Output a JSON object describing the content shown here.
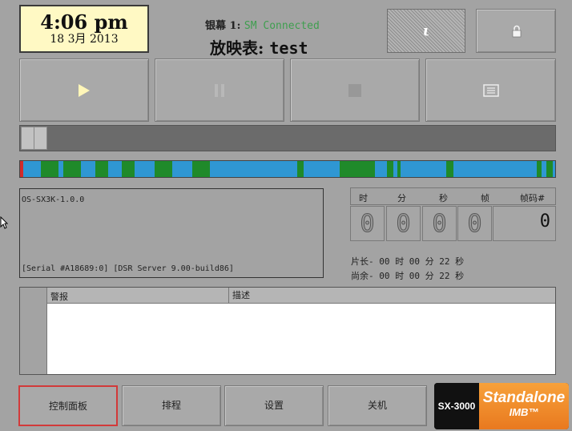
{
  "clock": {
    "time": "4:06 pm",
    "date": "18  3月 2013"
  },
  "header": {
    "screen_label": "银幕 1:",
    "connection_status": "SM Connected",
    "playlist_label": "放映表:",
    "playlist_name": "test",
    "status_color": "#3f9e4f"
  },
  "toolbar": {
    "info_glyph": "ι",
    "info_icon": "info-icon",
    "lock_icon": "lock-icon"
  },
  "transport": {
    "play_icon": "play-icon",
    "pause_icon": "pause-icon",
    "stop_icon": "stop-icon",
    "playlist_icon": "list-icon"
  },
  "timeline": {
    "position_percent": 0,
    "colors": {
      "content": "#2f97d3",
      "event": "#1f8a2a",
      "marker": "#d12b2b"
    }
  },
  "device_info": {
    "model": "OS-SX3K-1.0.0",
    "serial_line": "[Serial #A18689:0] [DSR Server 9.00-build86]"
  },
  "timecode": {
    "headers": [
      "时",
      "分",
      "秒",
      "帧",
      "帧码#"
    ],
    "digits": [
      "0",
      "0",
      "0",
      "0"
    ],
    "frame_code": "0",
    "duration": "片长- 00 时 00 分 22 秒",
    "remaining": "尚余- 00 时 00 分 22 秒"
  },
  "alarm_table": {
    "columns": [
      "警报",
      "描述"
    ],
    "rows": []
  },
  "bottom_nav": {
    "control_panel": "控制面板",
    "schedule": "排程",
    "settings": "设置",
    "shutdown": "关机",
    "active_color": "#d23a3a"
  },
  "logo": {
    "model": "SX-3000",
    "line1": "Standalone",
    "line2": "IMB™",
    "color": "#f08a2a"
  }
}
